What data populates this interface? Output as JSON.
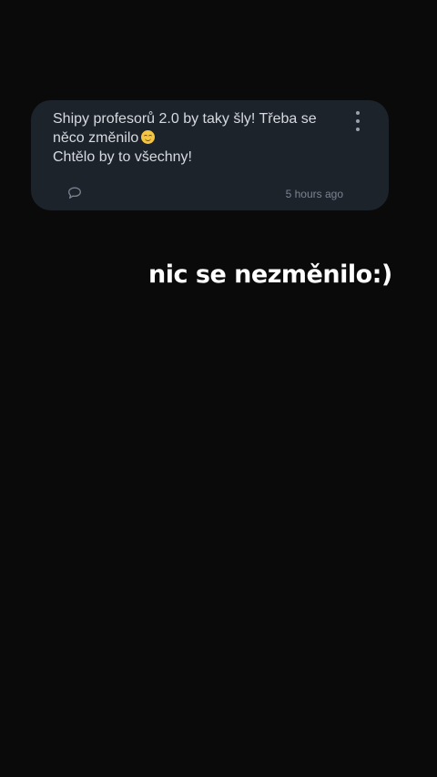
{
  "post": {
    "lines": [
      "Shipy profesorů 2.0 by taky šly! Třeba se",
      "něco změnilo",
      "Chtělo by to všechny!"
    ],
    "emoji": "grimacing-face-emoji",
    "timestamp": "5 hours ago",
    "icons": {
      "menu": "more-vertical-icon",
      "comment": "comment-bubble-icon"
    }
  },
  "overlay": {
    "text": "nic se nezměnilo:)"
  }
}
